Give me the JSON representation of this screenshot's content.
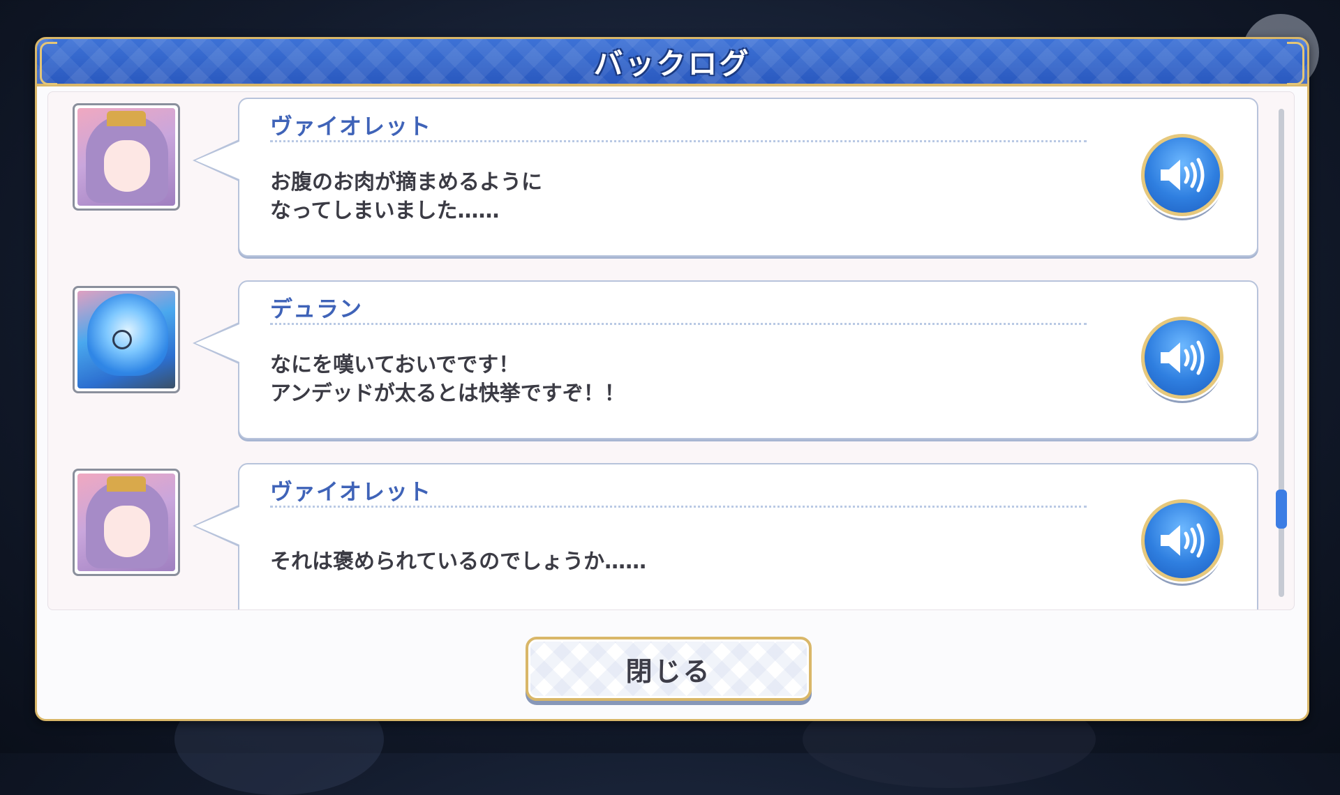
{
  "dialog": {
    "title": "バックログ",
    "close_label": "閉じる"
  },
  "entries": [
    {
      "speaker": "ヴァイオレット",
      "lines": [
        "お腹のお肉が摘まめるように",
        "なってしまいました……"
      ],
      "portrait": "violet-portrait",
      "voice_icon": "speaker-icon"
    },
    {
      "speaker": "デュラン",
      "lines": [
        "なにを嘆いておいでです！",
        "アンデッドが太るとは快挙ですぞ！！"
      ],
      "portrait": "duran-portrait",
      "voice_icon": "speaker-icon"
    },
    {
      "speaker": "ヴァイオレット",
      "lines": [
        "それは褒められているのでしょうか……"
      ],
      "portrait": "violet-portrait",
      "voice_icon": "speaker-icon"
    }
  ],
  "scrollbar": {
    "position": 0.85
  },
  "colors": {
    "header_blue": "#2a59bf",
    "gold_border": "#d9b769",
    "speaker_name": "#3f63b8",
    "voice_button": "#2f7fe0"
  }
}
